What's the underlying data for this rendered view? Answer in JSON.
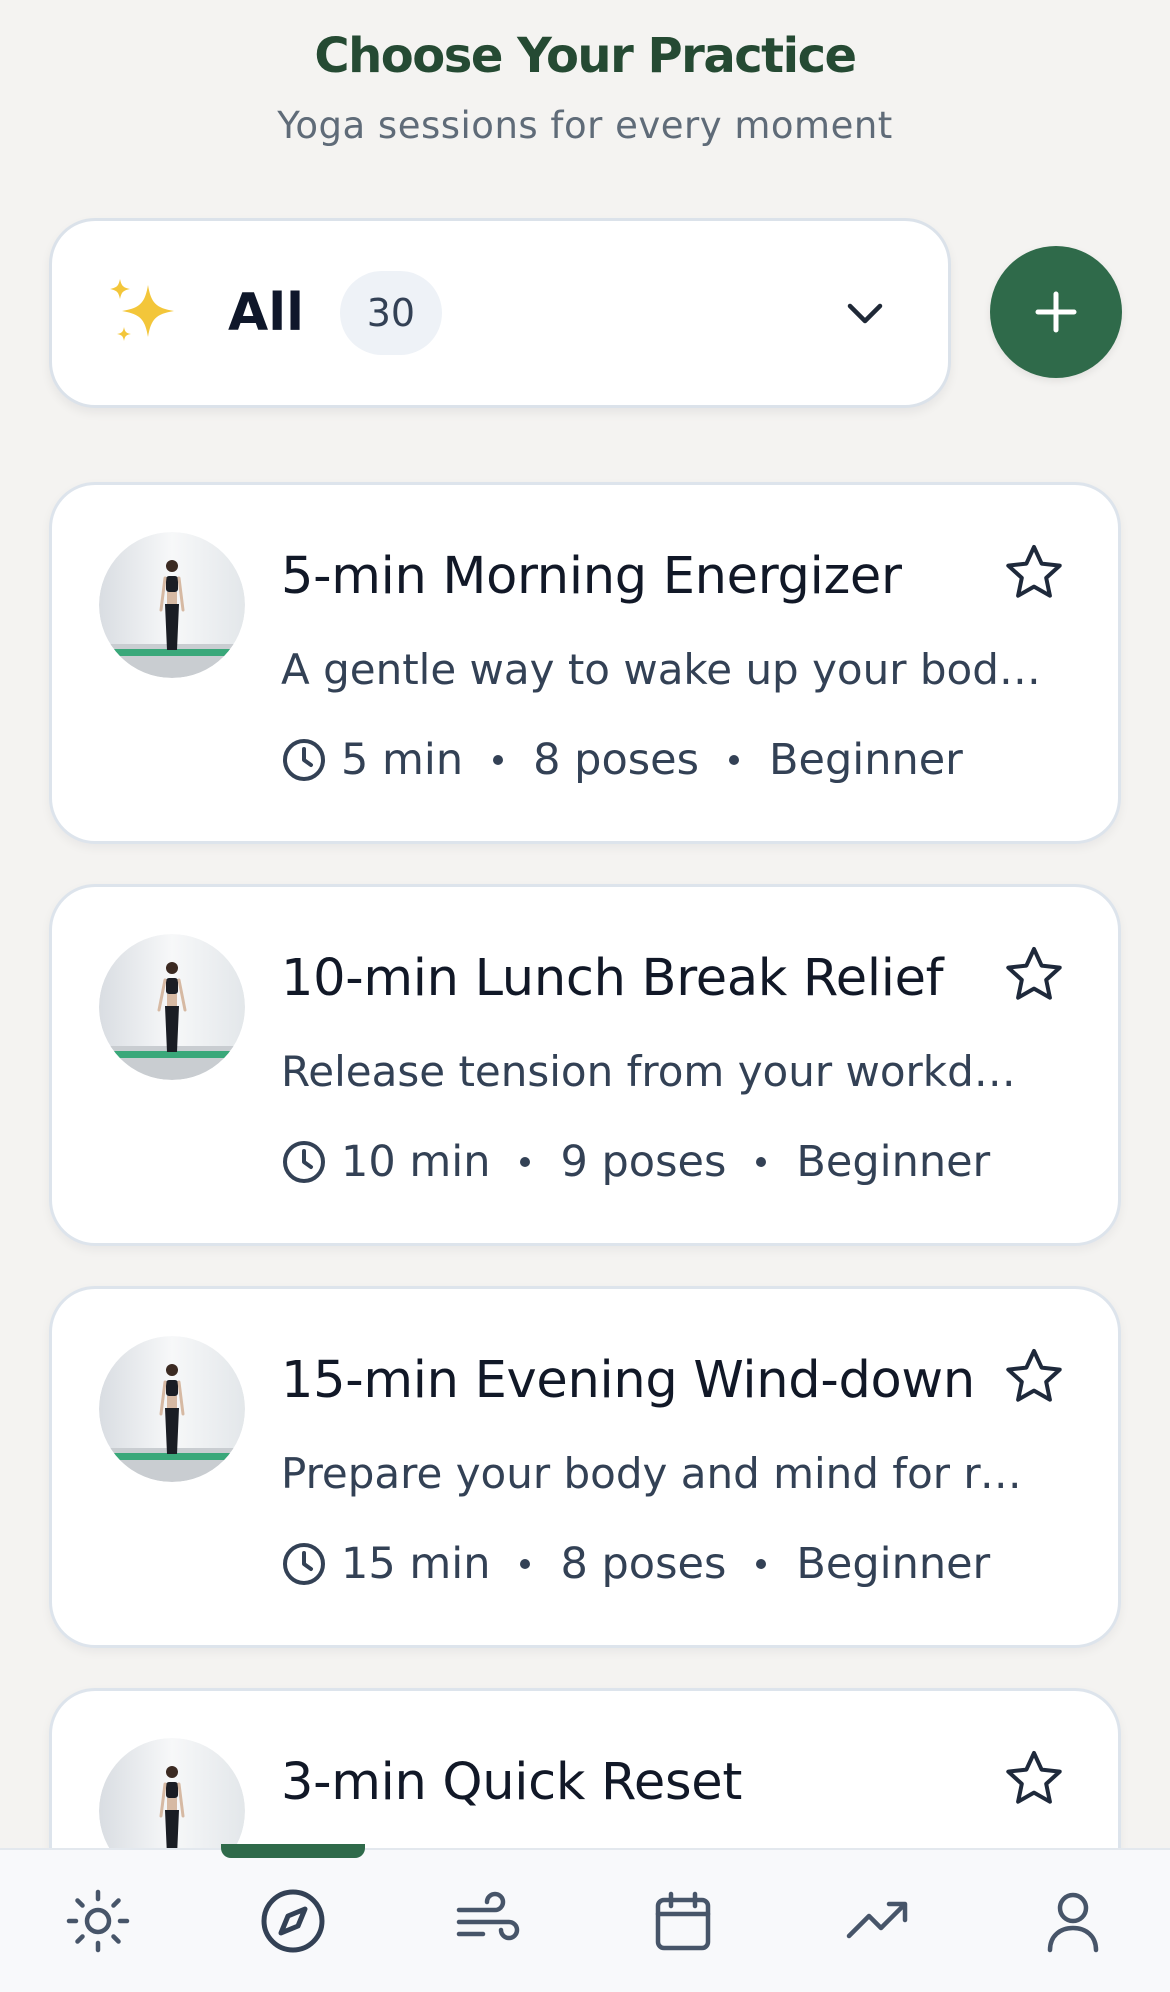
{
  "header": {
    "title": "Choose Your Practice",
    "subtitle": "Yoga sessions for every moment"
  },
  "filter": {
    "icon": "sparkles-icon",
    "label": "All",
    "count": "30"
  },
  "add_button": {
    "icon": "plus-icon"
  },
  "sessions": [
    {
      "title": "5-min Morning Energizer",
      "description": "A gentle way to wake up your body and start the day",
      "duration": "5 min",
      "poses": "8 poses",
      "level": "Beginner"
    },
    {
      "title": "10-min Lunch Break Relief",
      "description": "Release tension from your workday and reset",
      "duration": "10 min",
      "poses": "9 poses",
      "level": "Beginner"
    },
    {
      "title": "15-min Evening Wind-down",
      "description": "Prepare your body and mind for restful sleep",
      "duration": "15 min",
      "poses": "8 poses",
      "level": "Beginner"
    },
    {
      "title": "3-min Quick Reset",
      "description": "",
      "duration": "",
      "poses": "",
      "level": ""
    }
  ],
  "bottom_nav": {
    "active_index": 1,
    "items": [
      {
        "icon": "sun-icon"
      },
      {
        "icon": "compass-icon"
      },
      {
        "icon": "wind-icon"
      },
      {
        "icon": "calendar-icon"
      },
      {
        "icon": "trending-up-icon"
      },
      {
        "icon": "user-icon"
      }
    ]
  },
  "colors": {
    "accent": "#2f6a4a",
    "title": "#254a33",
    "background": "#f4f3f1",
    "text_secondary": "#334155"
  }
}
